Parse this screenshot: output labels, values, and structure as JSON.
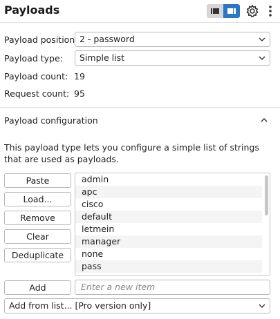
{
  "header": {
    "title": "Payloads",
    "icons": [
      "list-view-icon",
      "panel-view-icon",
      "gear-icon",
      "more-vertical-icon"
    ]
  },
  "settings": {
    "position_label": "Payload position:",
    "position_value": "2 - password",
    "type_label": "Payload type:",
    "type_value": "Simple list",
    "count_label": "Payload count:",
    "count_value": "19",
    "request_label": "Request count:",
    "request_value": "95"
  },
  "config": {
    "title": "Payload configuration",
    "description": "This payload type lets you configure a simple list of strings that are used as payloads.",
    "buttons": {
      "paste": "Paste",
      "load": "Load...",
      "remove": "Remove",
      "clear": "Clear",
      "dedupe": "Deduplicate",
      "add": "Add"
    },
    "items": [
      "admin",
      "apc",
      "cisco",
      "default",
      "letmein",
      "manager",
      "none",
      "pass"
    ],
    "new_item_placeholder": "Enter a new item",
    "add_from_list": "Add from list... [Pro version only]"
  },
  "colors": {
    "accent": "#2a77c4",
    "toggle_inactive": "#d6d6d6"
  }
}
